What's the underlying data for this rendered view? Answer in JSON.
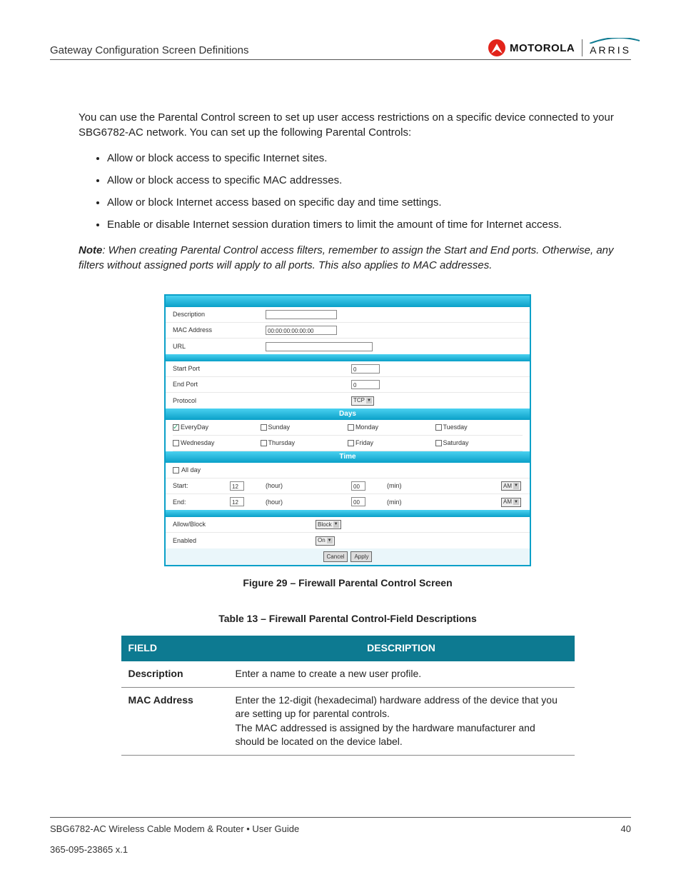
{
  "header": {
    "title": "Gateway Configuration Screen Definitions",
    "brand1": "MOTOROLA",
    "brand2": "ARRIS"
  },
  "intro": "You can use the Parental Control screen to set up user access restrictions on a specific device connected to your SBG6782-AC network. You can set up the following Parental Controls:",
  "bullets": [
    "Allow or block access to specific Internet sites.",
    "Allow or block access to specific MAC addresses.",
    "Allow or block Internet access based on specific day and time settings.",
    "Enable or disable Internet session duration timers to limit the amount of time for Internet access."
  ],
  "note": {
    "label": "Note",
    "text": ": When creating Parental Control access filters, remember to assign the Start and End ports. Otherwise, any filters without assigned ports will apply to all ports. This also applies to MAC addresses."
  },
  "screenshot": {
    "fields": {
      "description_label": "Description",
      "mac_label": "MAC Address",
      "mac_value": "00:00:00:00:00:00",
      "url_label": "URL",
      "startport_label": "Start Port",
      "startport_value": "0",
      "endport_label": "End Port",
      "endport_value": "0",
      "protocol_label": "Protocol",
      "protocol_value": "TCP"
    },
    "days_header": "Days",
    "days": [
      "EveryDay",
      "Sunday",
      "Monday",
      "Tuesday",
      "Wednesday",
      "Thursday",
      "Friday",
      "Saturday"
    ],
    "days_checked": [
      true,
      false,
      false,
      false,
      false,
      false,
      false,
      false
    ],
    "time_header": "Time",
    "time": {
      "allday": "All day",
      "start_label": "Start:",
      "end_label": "End:",
      "hour_val": "12",
      "hour_unit": "(hour)",
      "min_val": "00",
      "min_unit": "(min)",
      "ampm": "AM"
    },
    "allowblock_label": "Allow/Block",
    "allowblock_value": "Block",
    "enabled_label": "Enabled",
    "enabled_value": "On",
    "cancel": "Cancel",
    "apply": "Apply"
  },
  "figure_caption": "Figure 29 – Firewall Parental Control Screen",
  "table_title": "Table 13 – Firewall Parental Control-Field Descriptions",
  "table": {
    "head_field": "FIELD",
    "head_desc": "DESCRIPTION",
    "rows": [
      {
        "field": "Description",
        "desc": "Enter a name to create a new user profile."
      },
      {
        "field": "MAC Address",
        "desc": "Enter the 12-digit (hexadecimal) hardware address of the device that you are setting up for parental controls.\nThe MAC addressed is assigned by the hardware manufacturer and should be located on the device label."
      }
    ]
  },
  "footer": {
    "left": "SBG6782-AC Wireless Cable Modem & Router • User Guide",
    "page": "40",
    "partno": "365-095-23865  x.1"
  }
}
